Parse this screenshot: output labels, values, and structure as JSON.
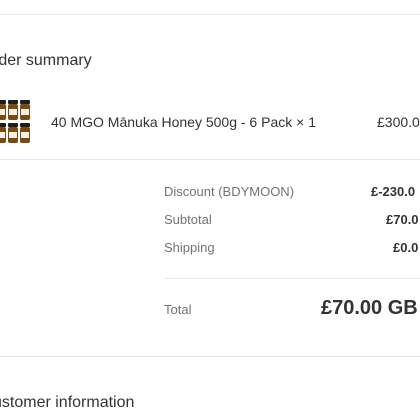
{
  "order_summary": {
    "title": "rder summary",
    "product": {
      "name": "40 MGO Mānuka Honey 500g - 6 Pack × 1",
      "price": "£300.0",
      "thumbnail_icon": "honey-jars-six-pack"
    },
    "discount": {
      "label": "Discount (BDYMOON)",
      "value": "£-230.0"
    },
    "subtotal": {
      "label": "Subtotal",
      "value": "£70.0"
    },
    "shipping": {
      "label": "Shipping",
      "value": "£0.0"
    },
    "total": {
      "label": "Total",
      "value": "£70.00 GB"
    }
  },
  "customer_information": {
    "title": "ustomer information"
  },
  "colors": {
    "text": "#333333",
    "muted": "#737373",
    "divider": "#e6e6e6",
    "jar_amber": "#7a4a12",
    "jar_lid": "#1e1e1e"
  }
}
